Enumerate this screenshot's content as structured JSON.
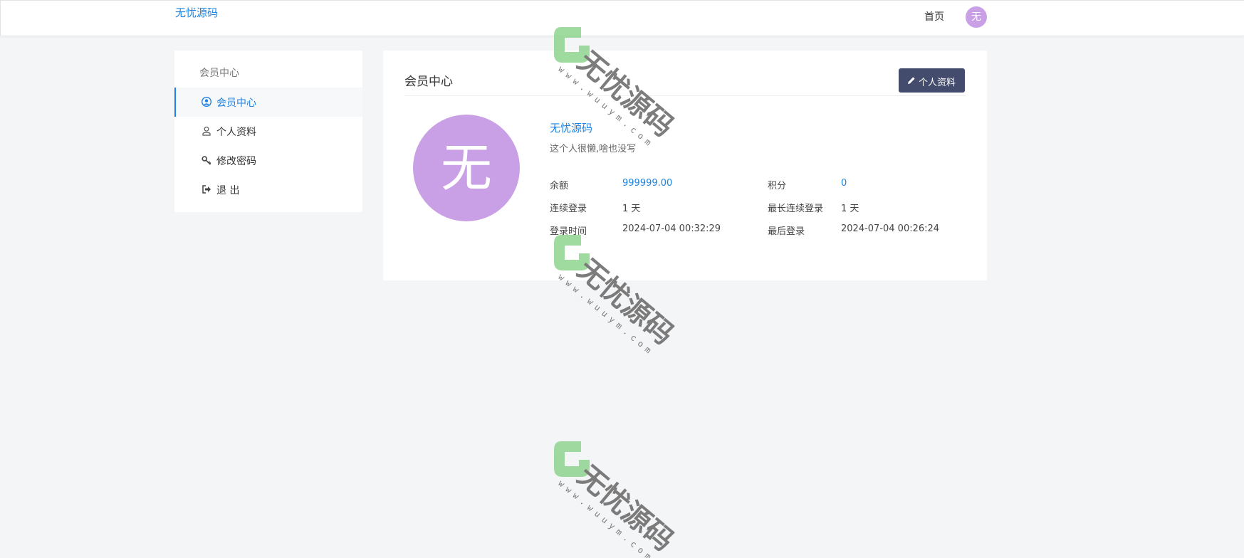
{
  "header": {
    "logo_text": "无忧源码",
    "nav_home": "首页",
    "avatar_char": "无"
  },
  "sidebar": {
    "title": "会员中心",
    "items": [
      {
        "label": "会员中心",
        "icon": "user-circle-icon",
        "active": true
      },
      {
        "label": "个人资料",
        "icon": "user-icon",
        "active": false
      },
      {
        "label": "修改密码",
        "icon": "key-icon",
        "active": false
      },
      {
        "label": "退 出",
        "icon": "sign-out-icon",
        "active": false
      }
    ]
  },
  "main": {
    "title": "会员中心",
    "profile_button": "个人资料",
    "avatar_char": "无",
    "username": "无忧源码",
    "bio": "这个人很懒,啥也没写",
    "stats": [
      {
        "label": "余额",
        "value": "999999.00"
      },
      {
        "label": "积分",
        "value": "0"
      },
      {
        "label": "连续登录",
        "value": "1 天"
      },
      {
        "label": "最长连续登录",
        "value": "1 天"
      },
      {
        "label": "登录时间",
        "value": "2024-07-04 00:32:29"
      },
      {
        "label": "最后登录",
        "value": "2024-07-04 00:26:24"
      }
    ]
  },
  "watermark": {
    "brand": "无忧源码",
    "url": "www.wuuym.com"
  },
  "colors": {
    "accent": "#1d82e0",
    "avatar": "#c9a0e6",
    "button": "#444c6e",
    "background": "#f4f5f7",
    "watermark_green": "#8fd48f"
  }
}
